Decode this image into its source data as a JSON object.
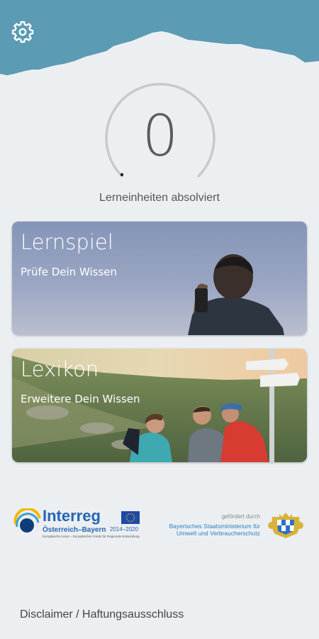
{
  "header": {
    "settings_icon": "gear-icon",
    "background_color": "#5b9bb4"
  },
  "progress": {
    "value": "0",
    "label": "Lerneinheiten absolviert",
    "fraction_complete": 0
  },
  "cards": [
    {
      "title": "Lernspiel",
      "subtitle": "Prüfe Dein Wissen"
    },
    {
      "title": "Lexikon",
      "subtitle": "Erweitere Dein Wissen"
    }
  ],
  "sponsors": {
    "interreg": {
      "name": "Interreg",
      "region": "Österreich–Bayern",
      "years": "2014–2020",
      "fineprint": "Europäische Union – Europäischer Fonds für Regionale Entwicklung"
    },
    "funded_by": "gefördert durch",
    "ministry": "Bayerisches Staatsministerium für Umwelt und Verbraucherschutz"
  },
  "footer": {
    "disclaimer": "Disclaimer / Haftungsausschluss"
  }
}
